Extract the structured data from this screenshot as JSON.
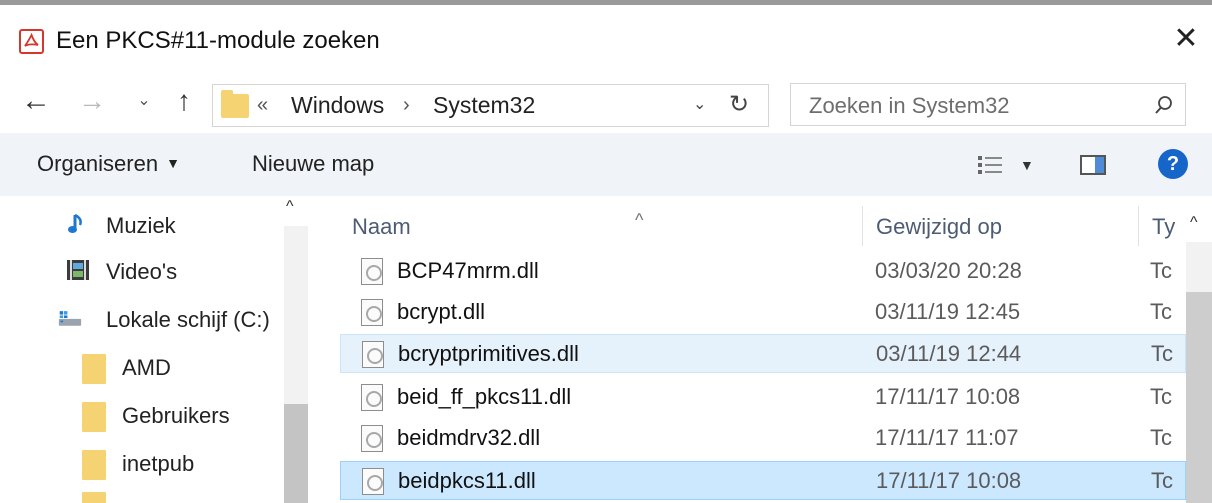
{
  "window": {
    "title": "Een PKCS#11-module zoeken",
    "close_glyph": "✕",
    "app_icon": "pdf-reader-icon"
  },
  "navigation": {
    "back_glyph": "←",
    "forward_glyph": "→",
    "recent_glyph": "⌄",
    "up_glyph": "↑"
  },
  "address": {
    "prefix": "«",
    "crumbs": [
      "Windows",
      "System32"
    ],
    "separator": "›",
    "dropdown_glyph": "⌄",
    "refresh_glyph": "↻"
  },
  "search": {
    "placeholder": "Zoeken in System32"
  },
  "toolbar": {
    "organize": "Organiseren",
    "organize_caret": "▼",
    "new_folder": "Nieuwe map",
    "view_caret": "▼",
    "help": "?"
  },
  "nav_pane": {
    "items": [
      {
        "label": "Muziek",
        "icon": "music-icon"
      },
      {
        "label": "Video's",
        "icon": "video-icon"
      },
      {
        "label": "Lokale schijf (C:)",
        "icon": "drive-icon"
      },
      {
        "label": "AMD",
        "icon": "folder-icon"
      },
      {
        "label": "Gebruikers",
        "icon": "folder-icon"
      },
      {
        "label": "inetpub",
        "icon": "folder-icon"
      }
    ],
    "scroll_up_glyph": "^"
  },
  "file_list": {
    "columns": {
      "name": "Naam",
      "modified": "Gewijzigd op",
      "type": "Ty"
    },
    "sort_glyph": "^",
    "scroll_up_glyph": "^",
    "rows": [
      {
        "name": "BCP47mrm.dll",
        "modified": "03/03/20 20:28",
        "type": "Tc",
        "state": "normal"
      },
      {
        "name": "bcrypt.dll",
        "modified": "03/11/19 12:45",
        "type": "Tc",
        "state": "normal"
      },
      {
        "name": "bcryptprimitives.dll",
        "modified": "03/11/19 12:44",
        "type": "Tc",
        "state": "hover"
      },
      {
        "name": "beid_ff_pkcs11.dll",
        "modified": "17/11/17 10:08",
        "type": "Tc",
        "state": "normal"
      },
      {
        "name": "beidmdrv32.dll",
        "modified": "17/11/17 11:07",
        "type": "Tc",
        "state": "normal"
      },
      {
        "name": "beidpkcs11.dll",
        "modified": "17/11/17 10:08",
        "type": "Tc",
        "state": "selected"
      }
    ]
  },
  "colors": {
    "accent": "#1566c8",
    "selection": "#cce8ff",
    "hover": "#e5f1fb",
    "folder": "#f6d372"
  }
}
